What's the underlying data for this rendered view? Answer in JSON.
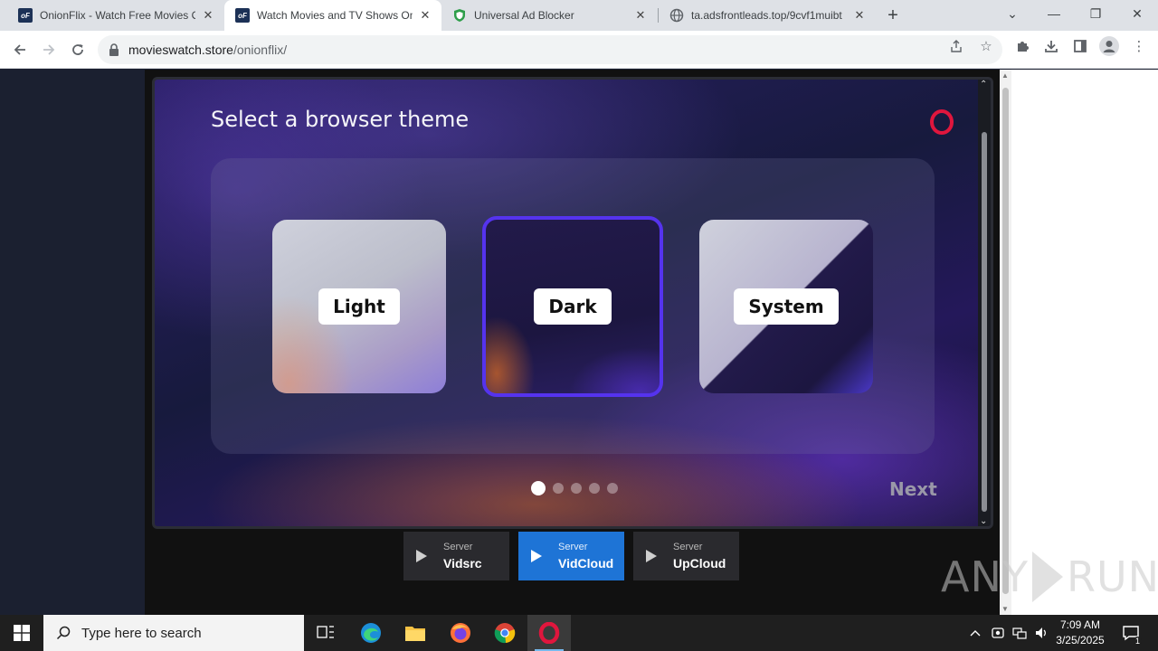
{
  "tabs": [
    {
      "title": "OnionFlix - Watch Free Movies Online",
      "icon": "onionflix-logo"
    },
    {
      "title": "Watch Movies and TV Shows Online",
      "icon": "onionflix-logo",
      "active": true
    },
    {
      "title": "Universal Ad Blocker",
      "icon": "shield-icon"
    },
    {
      "title": "ta.adsfrontleads.top/9cvf1muibt",
      "icon": "globe-icon"
    }
  ],
  "omnibox": {
    "domain": "movieswatch.store",
    "path": "/onionflix/"
  },
  "modal": {
    "title": "Select a browser theme",
    "themes": [
      {
        "label": "Light"
      },
      {
        "label": "Dark",
        "selected": true
      },
      {
        "label": "System"
      }
    ],
    "pagination": {
      "total": 5,
      "current": 1
    },
    "next_label": "Next",
    "brand_color": "#e0163d",
    "selected_border_color": "#5533ee"
  },
  "servers": [
    {
      "caption": "Server",
      "name": "Vidsrc",
      "active": false
    },
    {
      "caption": "Server",
      "name": "VidCloud",
      "active": true
    },
    {
      "caption": "Server",
      "name": "UpCloud",
      "active": false
    }
  ],
  "watermark": {
    "left": "ANY",
    "right": "RUN"
  },
  "taskbar": {
    "search_placeholder": "Type here to search",
    "time": "7:09 AM",
    "date": "3/25/2025",
    "notification_count": "1"
  }
}
